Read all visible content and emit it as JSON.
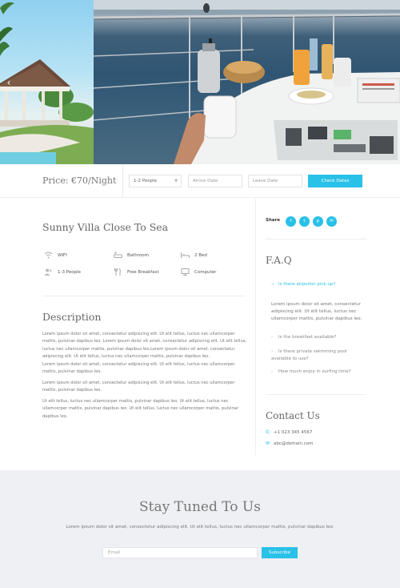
{
  "booking": {
    "price": "Price: €70/Night",
    "guests_value": "1-2 People",
    "arrive_placeholder": "Arrive Date",
    "leave_placeholder": "Leave Date",
    "check_label": "Check Dates"
  },
  "listing": {
    "title": "Sunny Villa Close To Sea",
    "features": [
      {
        "label": "WIFI",
        "icon": "wifi-icon"
      },
      {
        "label": "Bathroom",
        "icon": "bathtub-icon"
      },
      {
        "label": "2 Bed",
        "icon": "bed-icon"
      },
      {
        "label": "1-3 People",
        "icon": "people-icon"
      },
      {
        "label": "Free Breakfast",
        "icon": "cutlery-icon"
      },
      {
        "label": "Computer",
        "icon": "computer-icon"
      }
    ],
    "description_title": "Description",
    "paragraphs": [
      "Lorem ipsum dolor sit amet, consectetur adipiscing elit. Ut elit tellus, luctus nec ullamcorper mattis, pulvinar dapibus leo. Lorem ipsum dolor sit amet, consectetur adipiscing elit. Ut elit tellus, luctus nec ullamcorper mattis, pulvinar dapibus leo.Lorem ipsum dolor sit amet, consectetur adipiscing elit. Ut elit tellus, luctus nec ullamcorper mattis, pulvinar dapibus leo.",
      "Lorem ipsum dolor sit amet, consectetur adipiscing elit. Ut elit tellus, luctus nec ullamcorper mattis, pulvinar dapibus leo.",
      "Lorem ipsum dolor sit amet, consectetur adipiscing elit. Ut elit tellus, luctus nec ullamcorper mattis, pulvinar dapibus leo.",
      "Ut elit tellus, luctus nec ullamcorper mattis, pulvinar dapibus leo. Ut elit tellus, luctus nec ullamcorper mattis, pulvinar dapibus leo. Ut elit tellus, luctus nec ullamcorper mattis, pulvinar dapibus leo."
    ]
  },
  "sidebar": {
    "share_label": "Share",
    "social": [
      {
        "glyph": "f",
        "icon": "facebook-icon"
      },
      {
        "glyph": "t",
        "icon": "twitter-icon"
      },
      {
        "glyph": "p",
        "icon": "pinterest-icon"
      },
      {
        "glyph": "✉",
        "icon": "email-icon"
      }
    ],
    "faq_title": "F.A.Q",
    "faq_active_question": "Is there airporter pick-up?",
    "faq_answer": "Lorem ipsum dolor sit amet, consectetur adipiscing elit. Ut elit tellus, luctus nec ullamcorper mattis, pulvinar dapibus leo.",
    "faq_questions": [
      "Is the breakfast available?",
      "Is there private swimming pool available to use?",
      "How much enjoy in surfing time?"
    ],
    "contact_title": "Contact Us",
    "phone": "+1 023 345 4567",
    "email": "abc@domain.com"
  },
  "newsletter": {
    "title": "Stay Tuned To Us",
    "text": "Lorem ipsum dolor sit amet, consectetur adipiscing elit. Ut elit tellus, luctus nec ullamcorper mattis, pulvinar dapibus leo.",
    "email_placeholder": "Email",
    "subscribe_label": "Subscribe"
  },
  "colors": {
    "accent": "#29c1e7",
    "newsletter_bg": "#eef0f3"
  }
}
